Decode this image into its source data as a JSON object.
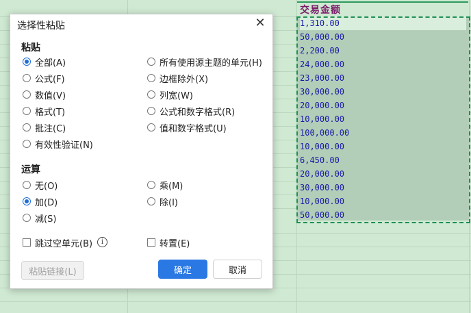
{
  "dialog": {
    "title": "选择性粘贴",
    "close_symbol": "✕",
    "paste_section": "粘贴",
    "paste_options_left": [
      {
        "label": "全部(A)",
        "selected": true
      },
      {
        "label": "公式(F)",
        "selected": false
      },
      {
        "label": "数值(V)",
        "selected": false
      },
      {
        "label": "格式(T)",
        "selected": false
      },
      {
        "label": "批注(C)",
        "selected": false
      },
      {
        "label": "有效性验证(N)",
        "selected": false
      }
    ],
    "paste_options_right": [
      {
        "label": "所有使用源主题的单元(H)",
        "selected": false
      },
      {
        "label": "边框除外(X)",
        "selected": false
      },
      {
        "label": "列宽(W)",
        "selected": false
      },
      {
        "label": "公式和数字格式(R)",
        "selected": false
      },
      {
        "label": "值和数字格式(U)",
        "selected": false
      }
    ],
    "operation_section": "运算",
    "operation_options_left": [
      {
        "label": "无(O)",
        "selected": false
      },
      {
        "label": "加(D)",
        "selected": true
      },
      {
        "label": "减(S)",
        "selected": false
      }
    ],
    "operation_options_right": [
      {
        "label": "乘(M)",
        "selected": false
      },
      {
        "label": "除(I)",
        "selected": false
      }
    ],
    "skip_blanks_label": "跳过空单元(B)",
    "skip_blanks_checked": false,
    "info_symbol": "i",
    "transpose_label": "转置(E)",
    "transpose_checked": false,
    "paste_link_label": "粘贴链接(L)",
    "ok_label": "确定",
    "cancel_label": "取消"
  },
  "sheet": {
    "column_header": "交易金额",
    "values": [
      "1,310.00",
      "50,000.00",
      "2,200.00",
      "24,000.00",
      "23,000.00",
      "30,000.00",
      "20,000.00",
      "10,000.00",
      "100,000.00",
      "10,000.00",
      "6,450.00",
      "20,000.00",
      "30,000.00",
      "10,000.00",
      "50,000.00"
    ]
  },
  "colors": {
    "accent": "#2a78e4",
    "sheet_background": "#cfe9d2",
    "selection_border": "#1f8f55",
    "cell_text": "#1a1aa8",
    "header_text": "#7a1a6a"
  }
}
